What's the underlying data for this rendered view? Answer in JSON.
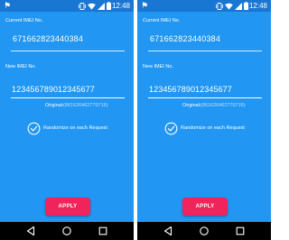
{
  "screens": [
    {
      "status_bar": {
        "notification_icon": "notification-icon",
        "time": "12:48"
      },
      "current_imei": {
        "label": "Current IMEI No.",
        "value": "671662823440384"
      },
      "new_imei": {
        "label": "New IMEI No.",
        "value": "123456789012345677",
        "placeholder": ""
      },
      "original": {
        "label": "Original:",
        "value": "(861626462770716)"
      },
      "randomize": {
        "label": "Randomize on each Request",
        "checked": true
      },
      "apply_label": "APPLY"
    },
    {
      "status_bar": {
        "notification_icon": "notification-icon",
        "time": "12:48"
      },
      "current_imei": {
        "label": "Current IMEI No.",
        "value": "671662823440384"
      },
      "new_imei": {
        "label": "New IMEI No.",
        "value": "123456789012345677",
        "placeholder": ""
      },
      "original": {
        "label": "Original:",
        "value": "(861626462770716)"
      },
      "randomize": {
        "label": "Randomize on each Request",
        "checked": true
      },
      "apply_label": "APPLY"
    }
  ],
  "icons": {
    "vibrate": "vibrate-icon",
    "wifi": "wifi-icon",
    "signal": "signal-icon",
    "battery": "battery-icon",
    "nav_back": "back-icon",
    "nav_home": "home-icon",
    "nav_recent": "recent-apps-icon"
  },
  "colors": {
    "screen_background": "#2196f3",
    "status_bar": "#1976d2",
    "apply_button": "#f0245a",
    "text": "#ffffff",
    "nav_bar": "#000000"
  }
}
